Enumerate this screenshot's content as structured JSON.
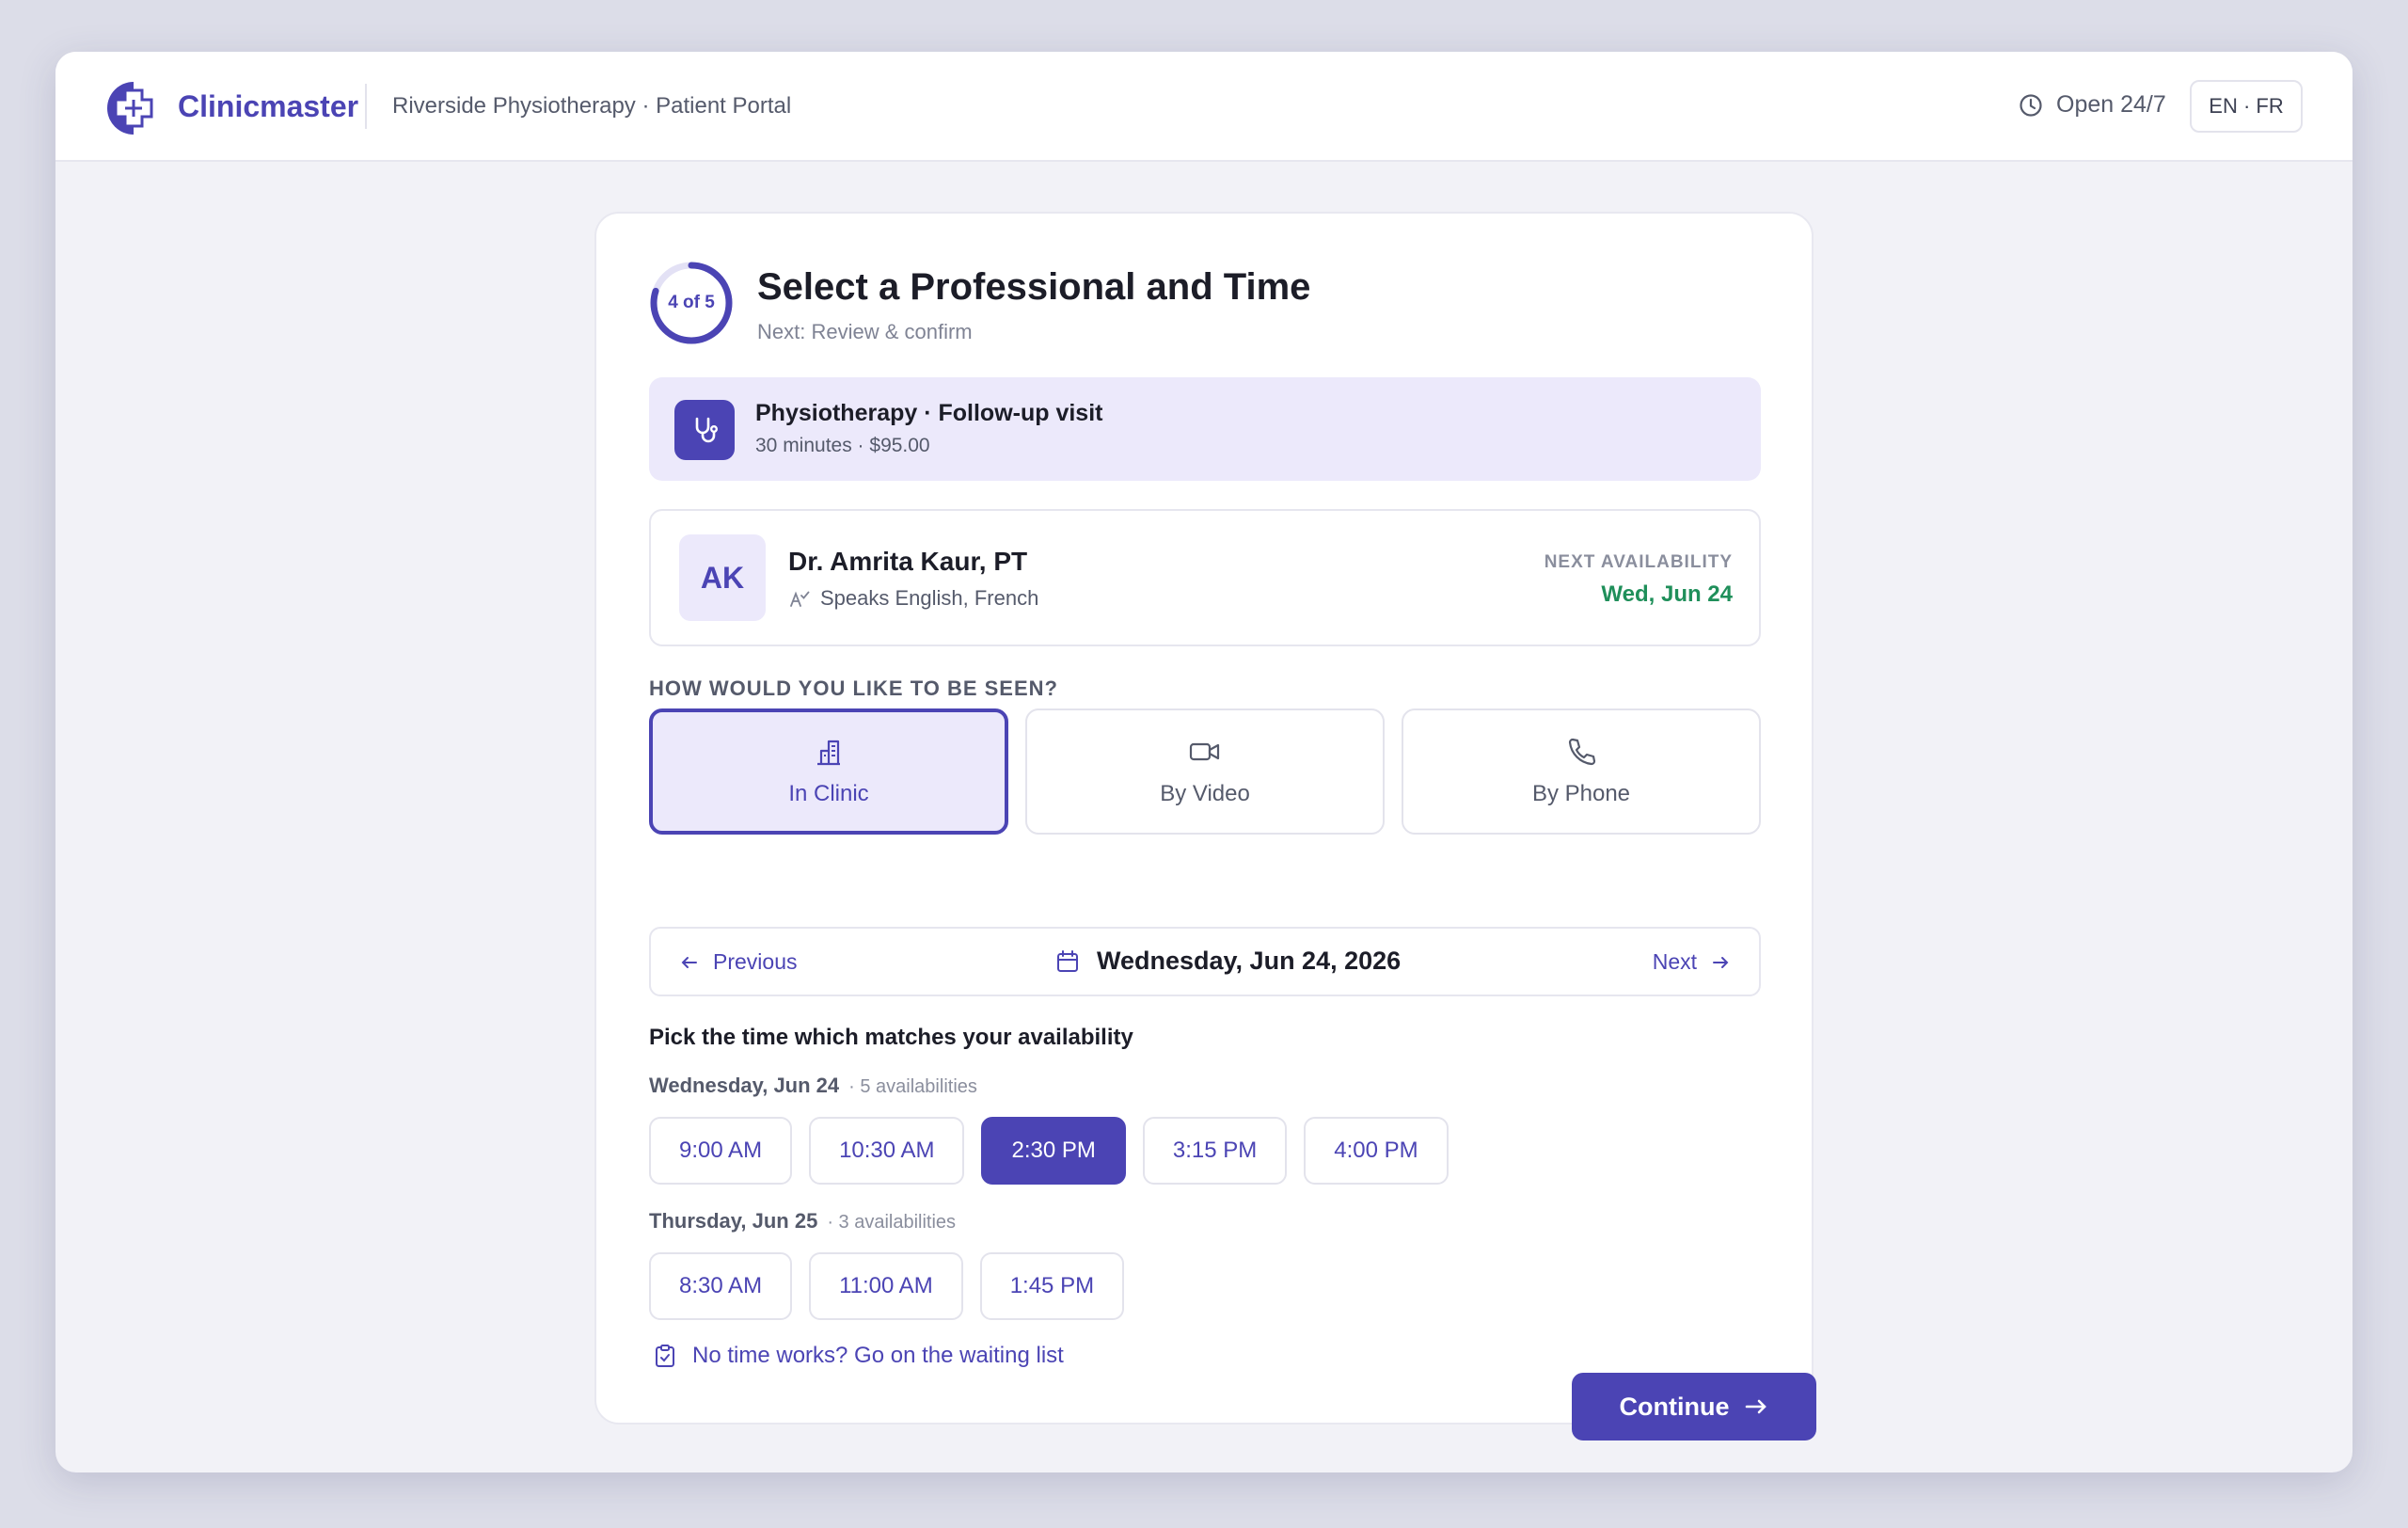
{
  "header": {
    "brand": "Clinicmaster",
    "portal": "Riverside Physiotherapy · Patient Portal",
    "hours": "Open 24/7",
    "language": "EN · FR"
  },
  "step": {
    "label": "4 of 5",
    "current": 4,
    "total": 5,
    "title": "Select a Professional and Time",
    "next": "Next: Review & confirm"
  },
  "service": {
    "name": "Physiotherapy · Follow-up visit",
    "meta": "30 minutes · $95.00"
  },
  "professional": {
    "initials": "AK",
    "name": "Dr. Amrita Kaur, PT",
    "languages": "Speaks English, French",
    "availability_label": "NEXT AVAILABILITY",
    "availability_value": "Wed, Jun 24"
  },
  "visit_mode": {
    "label": "HOW WOULD YOU LIKE TO BE SEEN?",
    "options": [
      {
        "label": "In Clinic",
        "icon": "building-icon",
        "selected": true
      },
      {
        "label": "By Video",
        "icon": "video-icon",
        "selected": false
      },
      {
        "label": "By Phone",
        "icon": "phone-icon",
        "selected": false
      }
    ]
  },
  "date_nav": {
    "previous": "Previous",
    "date": "Wednesday, Jun 24, 2026",
    "next": "Next"
  },
  "times": {
    "title": "Pick the time which matches your availability",
    "days": [
      {
        "day": "Wednesday, Jun 24",
        "count": "· 5 availabilities",
        "slots": [
          "9:00 AM",
          "10:30 AM",
          "2:30 PM",
          "3:15 PM",
          "4:00 PM"
        ],
        "selected": "2:30 PM"
      },
      {
        "day": "Thursday, Jun 25",
        "count": "· 3 availabilities",
        "slots": [
          "8:30 AM",
          "11:00 AM",
          "1:45 PM"
        ],
        "selected": ""
      }
    ]
  },
  "footer": {
    "waitlist": "No time works? Go on the waiting list",
    "continue": "Continue"
  },
  "colors": {
    "accent": "#4b44b4",
    "accent_soft": "#ece9fb",
    "success": "#1f8f5a"
  }
}
